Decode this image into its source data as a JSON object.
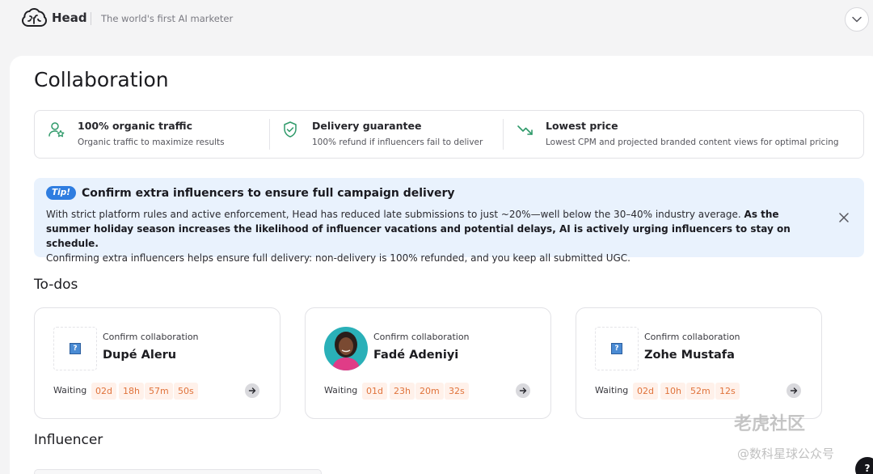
{
  "header": {
    "brand": "Head",
    "tagline": "The world's first AI marketer"
  },
  "page": {
    "title": "Collaboration"
  },
  "features": [
    {
      "icon": "user-star-icon",
      "title": "100% organic traffic",
      "desc": "Organic traffic to maximize results"
    },
    {
      "icon": "shield-check-icon",
      "title": "Delivery guarantee",
      "desc": "100% refund if influencers fail to deliver"
    },
    {
      "icon": "trend-down-icon",
      "title": "Lowest price",
      "desc": "Lowest CPM and projected branded content views for optimal pricing"
    }
  ],
  "tip": {
    "badge": "Tip!",
    "title": "Confirm extra influencers to ensure full campaign delivery",
    "body_part1": "With strict platform rules and active enforcement, Head has reduced late submissions to just ~20%—well below the 30–40% industry average. ",
    "body_bold": "As the summer holiday season increases the likelihood of influencer vacations and potential delays, AI is actively urging influencers to stay on schedule.",
    "body_part2": "Confirming extra influencers helps ensure full delivery: non-delivery is 100% refunded, and you keep all submitted UGC."
  },
  "todos": {
    "section_title": "To-dos",
    "items": [
      {
        "action": "Confirm collaboration",
        "name": "Dupé Aleru",
        "waiting_label": "Waiting",
        "timer": [
          "02d",
          "18h",
          "57m",
          "50s"
        ],
        "avatar": "placeholder"
      },
      {
        "action": "Confirm collaboration",
        "name": "Fadé Adeniyi",
        "waiting_label": "Waiting",
        "timer": [
          "01d",
          "23h",
          "20m",
          "32s"
        ],
        "avatar": "photo"
      },
      {
        "action": "Confirm collaboration",
        "name": "Zohe Mustafa",
        "waiting_label": "Waiting",
        "timer": [
          "02d",
          "10h",
          "52m",
          "12s"
        ],
        "avatar": "placeholder"
      }
    ]
  },
  "influencer": {
    "section_title": "Influencer"
  },
  "help": {
    "label": "?"
  },
  "watermark": {
    "line1": "老虎社区",
    "line2": "@数科星球公众号"
  },
  "colors": {
    "accent": "#2f7de0",
    "tip_bg": "#e9f2fd",
    "timer_text": "#e0733b",
    "timer_bg": "#fff1ea",
    "feature_icon": "#2f9a6a"
  }
}
